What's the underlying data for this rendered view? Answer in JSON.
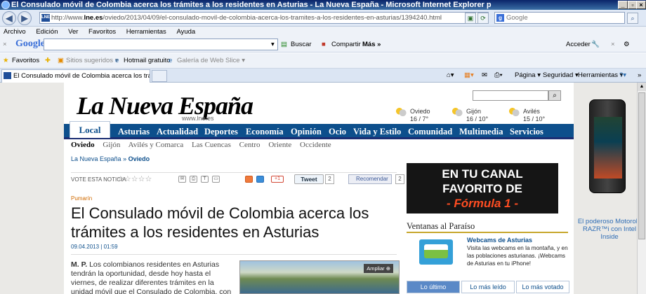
{
  "window": {
    "title": "El Consulado móvil de Colombia acerca los trámites a los residentes en Asturias - La Nueva España - Microsoft Internet Explorer p"
  },
  "address_bar": {
    "url_prefix": "http://www.",
    "url_domain": "lne.es",
    "url_path": "/oviedo/2013/04/09/el-consulado-movil-de-colombia-acerca-los-tramites-a-los-residentes-en-asturias/1394240.html",
    "search_placeholder": "Google"
  },
  "menu": [
    "Archivo",
    "Edición",
    "Ver",
    "Favoritos",
    "Herramientas",
    "Ayuda"
  ],
  "google_toolbar": {
    "logo": "Google",
    "buscar": "Buscar",
    "compartir": "Compartir",
    "mas": "Más »",
    "acceder": "Acceder"
  },
  "favorites_bar": {
    "favoritos": "Favoritos",
    "sitios": "Sitios sugeridos ▾",
    "hotmail": "Hotmail gratuito",
    "galeria": "Galería de Web Slice ▾"
  },
  "tab": {
    "label": "El Consulado móvil de Colombia acerca los trámites a l..."
  },
  "command_bar": {
    "pagina": "Página ▾",
    "seguridad": "Seguridad ▾",
    "herramientas": "Herramientas ▾"
  },
  "site": {
    "logo": "La Nueva España",
    "url": "www.lne.es",
    "weather": [
      {
        "city": "Oviedo",
        "temp": "16 / 7°"
      },
      {
        "city": "Gijón",
        "temp": "16 / 10°"
      },
      {
        "city": "Avilés",
        "temp": "15 / 10°"
      }
    ],
    "nav": {
      "local": "Local",
      "items": [
        "Asturias",
        "Actualidad",
        "Deportes",
        "Economía",
        "Opinión",
        "Ocio",
        "Vida y Estilo",
        "Comunidad",
        "Multimedia",
        "Servicios"
      ]
    },
    "subnav": [
      "Oviedo",
      "Gijón",
      "Avilés y Comarca",
      "Las Cuencas",
      "Centro",
      "Oriente",
      "Occidente"
    ]
  },
  "article": {
    "breadcrumb_home": "La Nueva España",
    "breadcrumb_sep": "»",
    "breadcrumb_section": "Oviedo",
    "vote_label": "VOTE ESTA NOTICIA",
    "tweet": "Tweet",
    "tweet_count": "2",
    "recommend": "Recomendar",
    "recommend_count": "2",
    "kicker": "Pumarín",
    "headline": "El Consulado móvil de Colombia acerca los trámites a los residentes en Asturias",
    "date": "09.04.2013 | 01:59",
    "author": "M. P.",
    "body": "Los colombianos residentes en Asturias tendrán la oportunidad, desde hoy hasta el viernes, de realizar diferentes trámites en la unidad móvil que el Consulado de Colombia, con",
    "photo_button": "Ampliar"
  },
  "sidebar": {
    "ad_line1": "EN TU CANAL",
    "ad_line2": "FAVORITO DE",
    "ad_line3": "- Fórmula 1 -",
    "ventanas_title": "Ventanas al Paraíso",
    "webcam_title": "Webcams de Asturias",
    "webcam_desc": "Visita las webcams en la montaña, y en las poblaciones asturianas. ¡Webcams de Asturias en tu iPhone!",
    "tabs": [
      "Lo último",
      "Lo más leído",
      "Lo más votado"
    ]
  },
  "right_ad": {
    "text": "El poderoso Motorola RAZR™i con Intel Inside"
  }
}
